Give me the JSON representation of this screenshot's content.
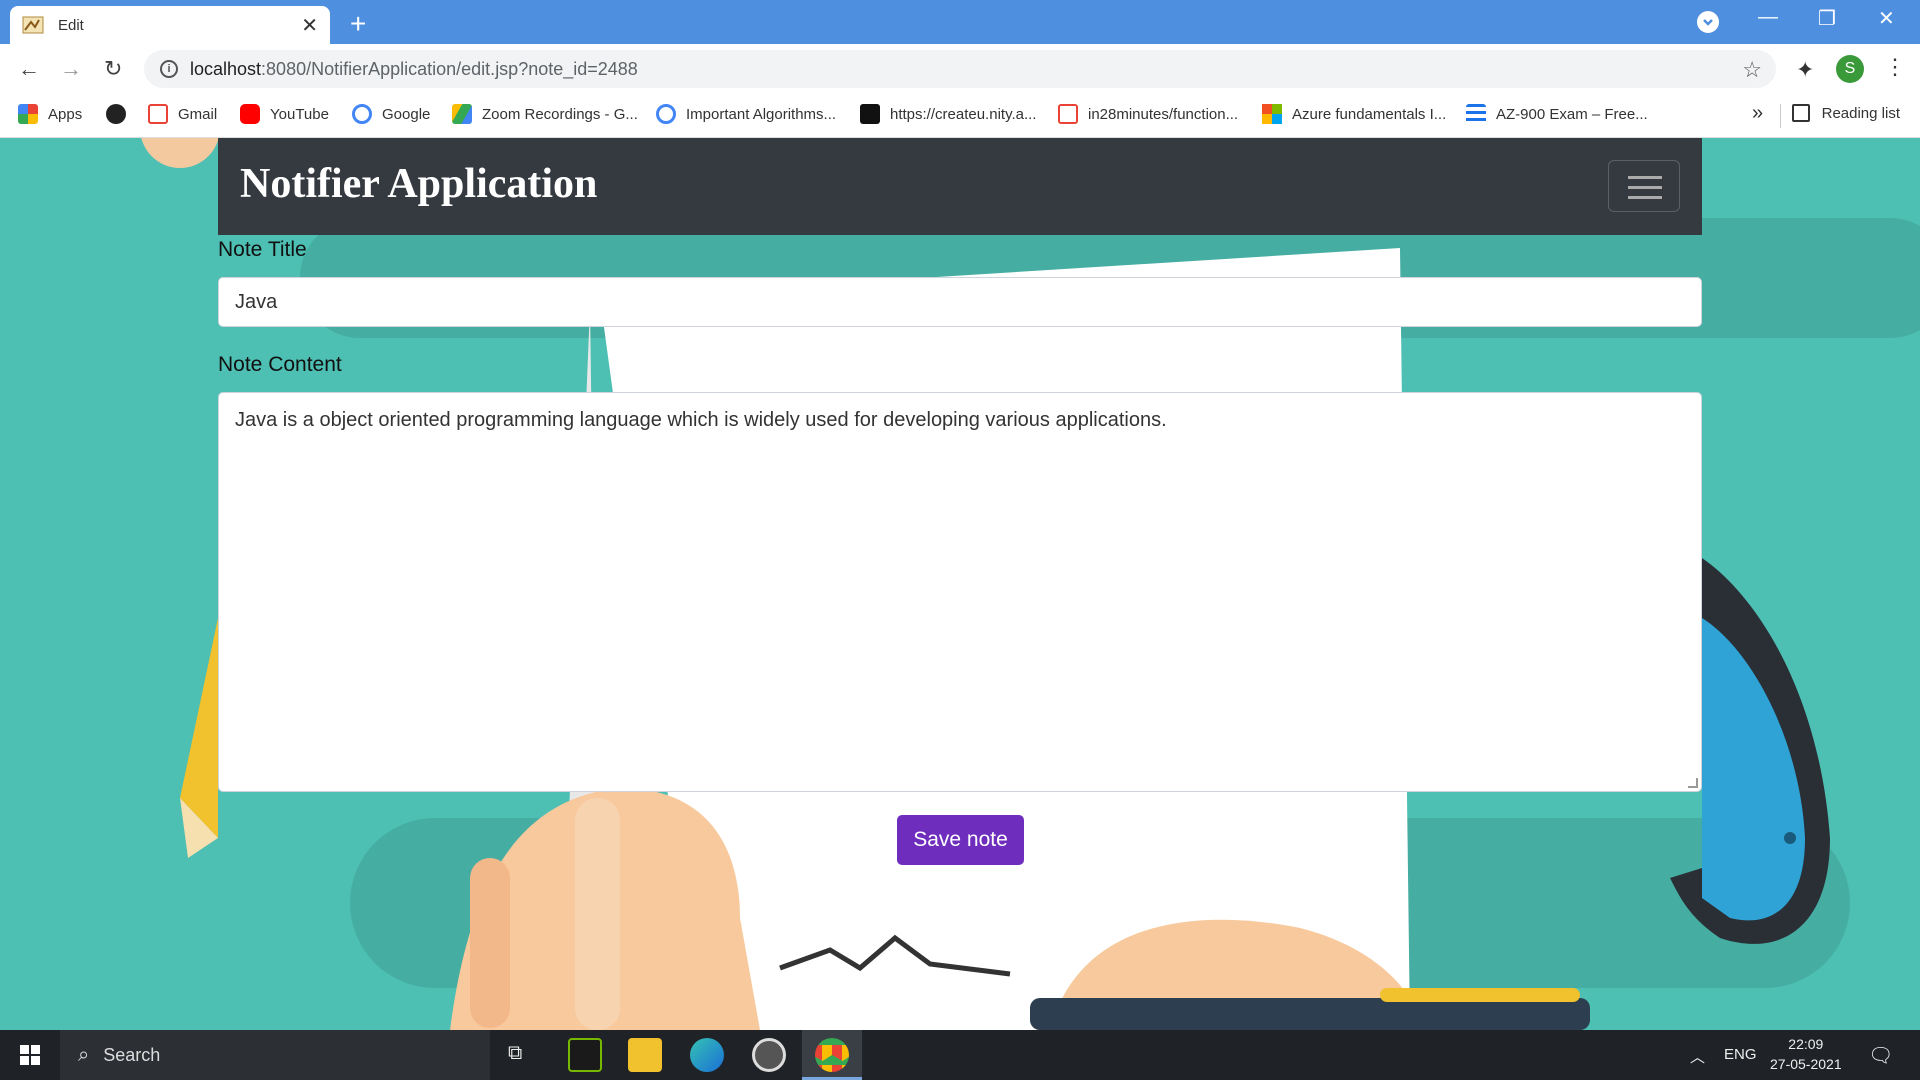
{
  "browser": {
    "tab_title": "Edit",
    "url_host": "localhost",
    "url_path": ":8080/NotifierApplication/edit.jsp?note_id=2488",
    "bookmarks": [
      {
        "label": "Apps",
        "icon": "apps-grid-icon"
      },
      {
        "label": "",
        "icon": "globe-icon"
      },
      {
        "label": "Gmail",
        "icon": "gmail-icon"
      },
      {
        "label": "YouTube",
        "icon": "youtube-icon"
      },
      {
        "label": "Google",
        "icon": "google-icon"
      },
      {
        "label": "Zoom Recordings - G...",
        "icon": "google-drive-icon"
      },
      {
        "label": "Important Algorithms...",
        "icon": "google-icon"
      },
      {
        "label": "https://createu.nity.a...",
        "icon": "site-icon"
      },
      {
        "label": "in28minutes/function...",
        "icon": "gmail-icon"
      },
      {
        "label": "Azure fundamentals I...",
        "icon": "microsoft-icon"
      },
      {
        "label": "AZ-900 Exam – Free...",
        "icon": "list-icon"
      }
    ],
    "reading_list": "Reading list",
    "profile_initial": "S"
  },
  "app": {
    "brand": "Notifier Application",
    "note_title_label": "Note Title",
    "note_title_value": "Java",
    "note_content_label": "Note Content",
    "note_content_value": "Java is a object oriented programming language which is widely used for developing various applications.",
    "save_label": "Save note"
  },
  "taskbar": {
    "search_label": "Search",
    "language": "ENG",
    "time": "22:09",
    "date": "27-05-2021"
  },
  "colors": {
    "navbar": "#343a40",
    "save_button": "#6f2dbd",
    "background_teal": "#4dbfb3",
    "tabstrip": "#4f8fe0"
  }
}
